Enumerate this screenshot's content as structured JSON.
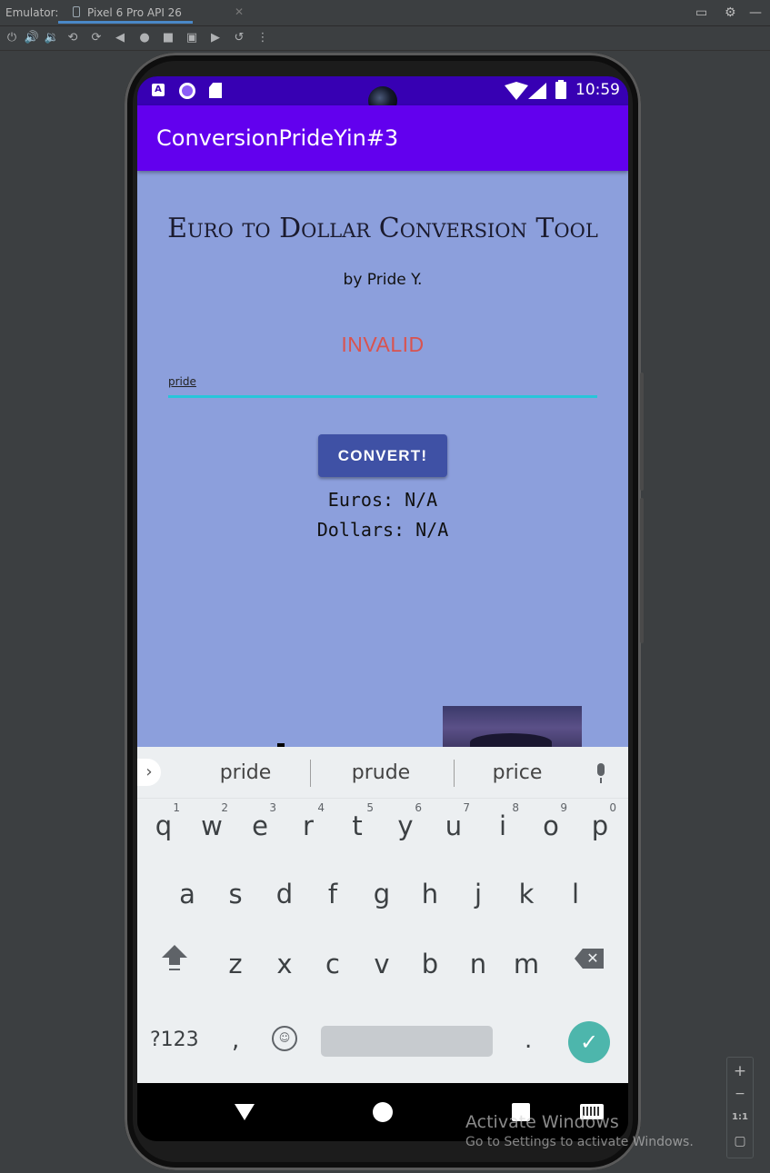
{
  "emulator": {
    "label": "Emulator:",
    "device_tab": "Pixel 6 Pro API 26",
    "close_glyph": "✕",
    "toolbar_icons": [
      "power-icon",
      "volume-up-icon",
      "volume-down-icon",
      "rotate-left-icon",
      "rotate-right-icon",
      "back-icon",
      "home-icon",
      "overview-icon",
      "screenshot-icon",
      "screen-record-icon",
      "snapshot-icon",
      "more-icon"
    ]
  },
  "status_bar": {
    "time": "10:59",
    "icons": [
      "app-a-icon",
      "record-icon",
      "sd-card-icon",
      "wifi-icon",
      "signal-icon",
      "battery-icon"
    ]
  },
  "app_bar": {
    "title": "ConversionPrideYin#3"
  },
  "content": {
    "title": "Euro to Dollar Conversion Tool",
    "byline": "by Pride Y.",
    "error_text": "INVALID",
    "input_value": "pride",
    "convert_label": "CONVERT!",
    "euros_text": "Euros: N/A",
    "dollars_text": "Dollars: N/A"
  },
  "keyboard": {
    "suggestions": [
      "pride",
      "prude",
      "price"
    ],
    "row1": [
      {
        "ch": "q",
        "num": "1"
      },
      {
        "ch": "w",
        "num": "2"
      },
      {
        "ch": "e",
        "num": "3"
      },
      {
        "ch": "r",
        "num": "4"
      },
      {
        "ch": "t",
        "num": "5"
      },
      {
        "ch": "y",
        "num": "6"
      },
      {
        "ch": "u",
        "num": "7"
      },
      {
        "ch": "i",
        "num": "8"
      },
      {
        "ch": "o",
        "num": "9"
      },
      {
        "ch": "p",
        "num": "0"
      }
    ],
    "row2": [
      "a",
      "s",
      "d",
      "f",
      "g",
      "h",
      "j",
      "k",
      "l"
    ],
    "row3": [
      "z",
      "x",
      "c",
      "v",
      "b",
      "n",
      "m"
    ],
    "symbols_label": "?123",
    "comma_label": ",",
    "period_label": ".",
    "enter_glyph": "✓"
  },
  "zoom_controls": {
    "plus": "+",
    "minus": "−",
    "ratio": "1:1"
  },
  "watermark": {
    "title": "Activate Windows",
    "subtitle": "Go to Settings to activate Windows."
  },
  "colors": {
    "status_bar": "#3700b3",
    "app_bar": "#6200ee",
    "content_bg": "#8c9fdc",
    "convert_button": "#3f51a5",
    "error_text": "#d9534f",
    "input_underline": "#26c6da",
    "enter_key": "#4db6ac"
  }
}
